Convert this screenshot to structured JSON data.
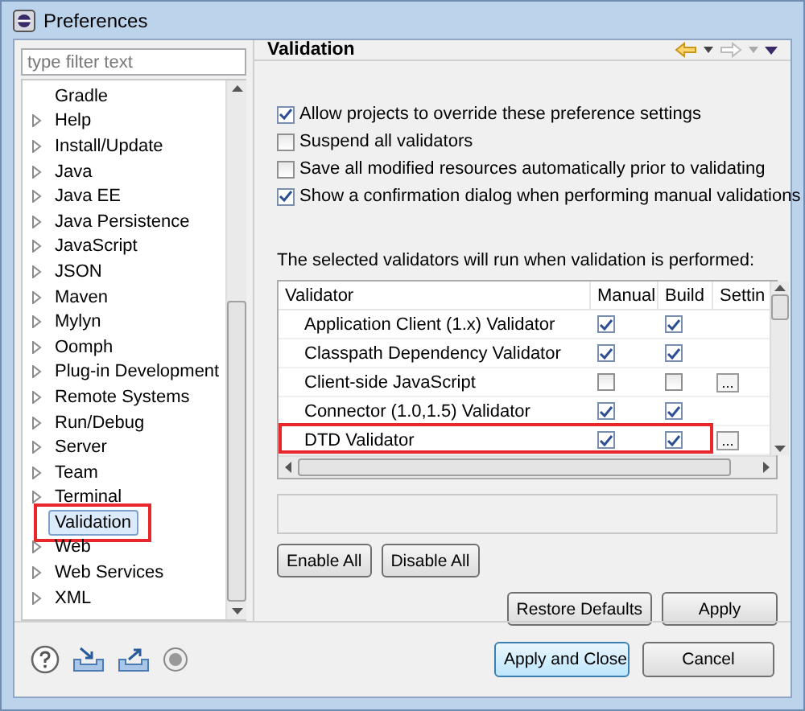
{
  "window": {
    "title": "Preferences"
  },
  "filter": {
    "placeholder": "type filter text"
  },
  "tree": [
    {
      "label": "Gradle",
      "has_children": false,
      "selected": false,
      "highlighted": false
    },
    {
      "label": "Help",
      "has_children": true,
      "selected": false,
      "highlighted": false
    },
    {
      "label": "Install/Update",
      "has_children": true,
      "selected": false,
      "highlighted": false
    },
    {
      "label": "Java",
      "has_children": true,
      "selected": false,
      "highlighted": false
    },
    {
      "label": "Java EE",
      "has_children": true,
      "selected": false,
      "highlighted": false
    },
    {
      "label": "Java Persistence",
      "has_children": true,
      "selected": false,
      "highlighted": false
    },
    {
      "label": "JavaScript",
      "has_children": true,
      "selected": false,
      "highlighted": false
    },
    {
      "label": "JSON",
      "has_children": true,
      "selected": false,
      "highlighted": false
    },
    {
      "label": "Maven",
      "has_children": true,
      "selected": false,
      "highlighted": false
    },
    {
      "label": "Mylyn",
      "has_children": true,
      "selected": false,
      "highlighted": false
    },
    {
      "label": "Oomph",
      "has_children": true,
      "selected": false,
      "highlighted": false
    },
    {
      "label": "Plug-in Development",
      "has_children": true,
      "selected": false,
      "highlighted": false
    },
    {
      "label": "Remote Systems",
      "has_children": true,
      "selected": false,
      "highlighted": false
    },
    {
      "label": "Run/Debug",
      "has_children": true,
      "selected": false,
      "highlighted": false
    },
    {
      "label": "Server",
      "has_children": true,
      "selected": false,
      "highlighted": false
    },
    {
      "label": "Team",
      "has_children": true,
      "selected": false,
      "highlighted": false
    },
    {
      "label": "Terminal",
      "has_children": true,
      "selected": false,
      "highlighted": false
    },
    {
      "label": "Validation",
      "has_children": false,
      "selected": true,
      "highlighted": true
    },
    {
      "label": "Web",
      "has_children": true,
      "selected": false,
      "highlighted": false
    },
    {
      "label": "Web Services",
      "has_children": true,
      "selected": false,
      "highlighted": false
    },
    {
      "label": "XML",
      "has_children": true,
      "selected": false,
      "highlighted": false
    }
  ],
  "page": {
    "title": "Validation",
    "options": [
      {
        "label": "Allow projects to override these preference settings",
        "checked": true
      },
      {
        "label": "Suspend all validators",
        "checked": false
      },
      {
        "label": "Save all modified resources automatically prior to validating",
        "checked": false
      },
      {
        "label": "Show a confirmation dialog when performing manual validations",
        "checked": true
      }
    ],
    "table_caption": "The selected validators will run when validation is performed:",
    "table": {
      "columns": [
        "Validator",
        "Manual",
        "Build",
        "Settin"
      ],
      "rows": [
        {
          "name": "Application Client (1.x) Validator",
          "manual": true,
          "build": true,
          "highlighted": false
        },
        {
          "name": "Classpath Dependency Validator",
          "manual": true,
          "build": true,
          "highlighted": false
        },
        {
          "name": "Client-side JavaScript",
          "manual": false,
          "build": false,
          "settings": "...",
          "highlighted": false
        },
        {
          "name": "Connector (1.0,1.5) Validator",
          "manual": true,
          "build": true,
          "highlighted": false
        },
        {
          "name": "DTD Validator",
          "manual": true,
          "build": true,
          "settings": "...",
          "highlighted": true
        }
      ]
    },
    "buttons": [
      "Enable All",
      "Disable All"
    ],
    "page_buttons": [
      "Restore Defaults",
      "Apply"
    ]
  },
  "dialog_buttons": [
    {
      "label": "Apply and Close",
      "default": true
    },
    {
      "label": "Cancel",
      "default": false
    }
  ]
}
